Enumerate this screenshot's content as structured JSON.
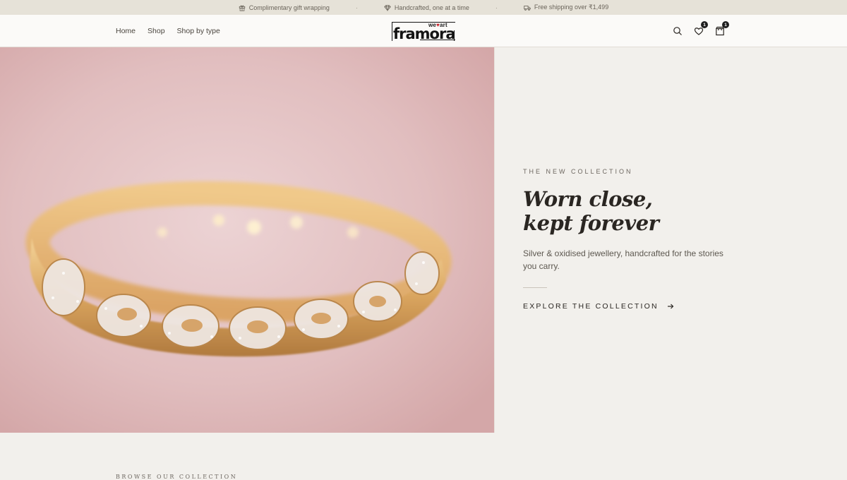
{
  "announcement": {
    "items": [
      {
        "icon": "gift-icon",
        "text": "Complimentary gift wrapping"
      },
      {
        "icon": "diamond-icon",
        "text": "Handcrafted, one at a time"
      },
      {
        "icon": "truck-icon",
        "text": "Free shipping over ₹1,499"
      }
    ],
    "separator": "·"
  },
  "header": {
    "nav": [
      "Home",
      "Shop",
      "Shop by type"
    ],
    "logo": {
      "tag_we": "we",
      "tag_art": "art",
      "brand": "framora"
    },
    "icons": {
      "search": "search-icon",
      "wishlist": "heart-icon",
      "cart": "shopping-bag-icon"
    },
    "wishlist_count": "1",
    "cart_count": "1"
  },
  "hero": {
    "image": "gold-paisley-bangle-photo",
    "eyebrow": "THE NEW COLLECTION",
    "headline_line1": "Worn close,",
    "headline_line2": "kept forever",
    "subtext": "Silver & oxidised jewellery, handcrafted for the stories you carry.",
    "cta": "EXPLORE THE COLLECTION",
    "cta_icon": "arrow-right-icon"
  },
  "section": {
    "browse_label": "BROWSE OUR COLLECTION"
  },
  "colors": {
    "accent_heart": "#c8232c",
    "background": "#f2f0ec",
    "announce_bg": "#e6e2d8"
  }
}
